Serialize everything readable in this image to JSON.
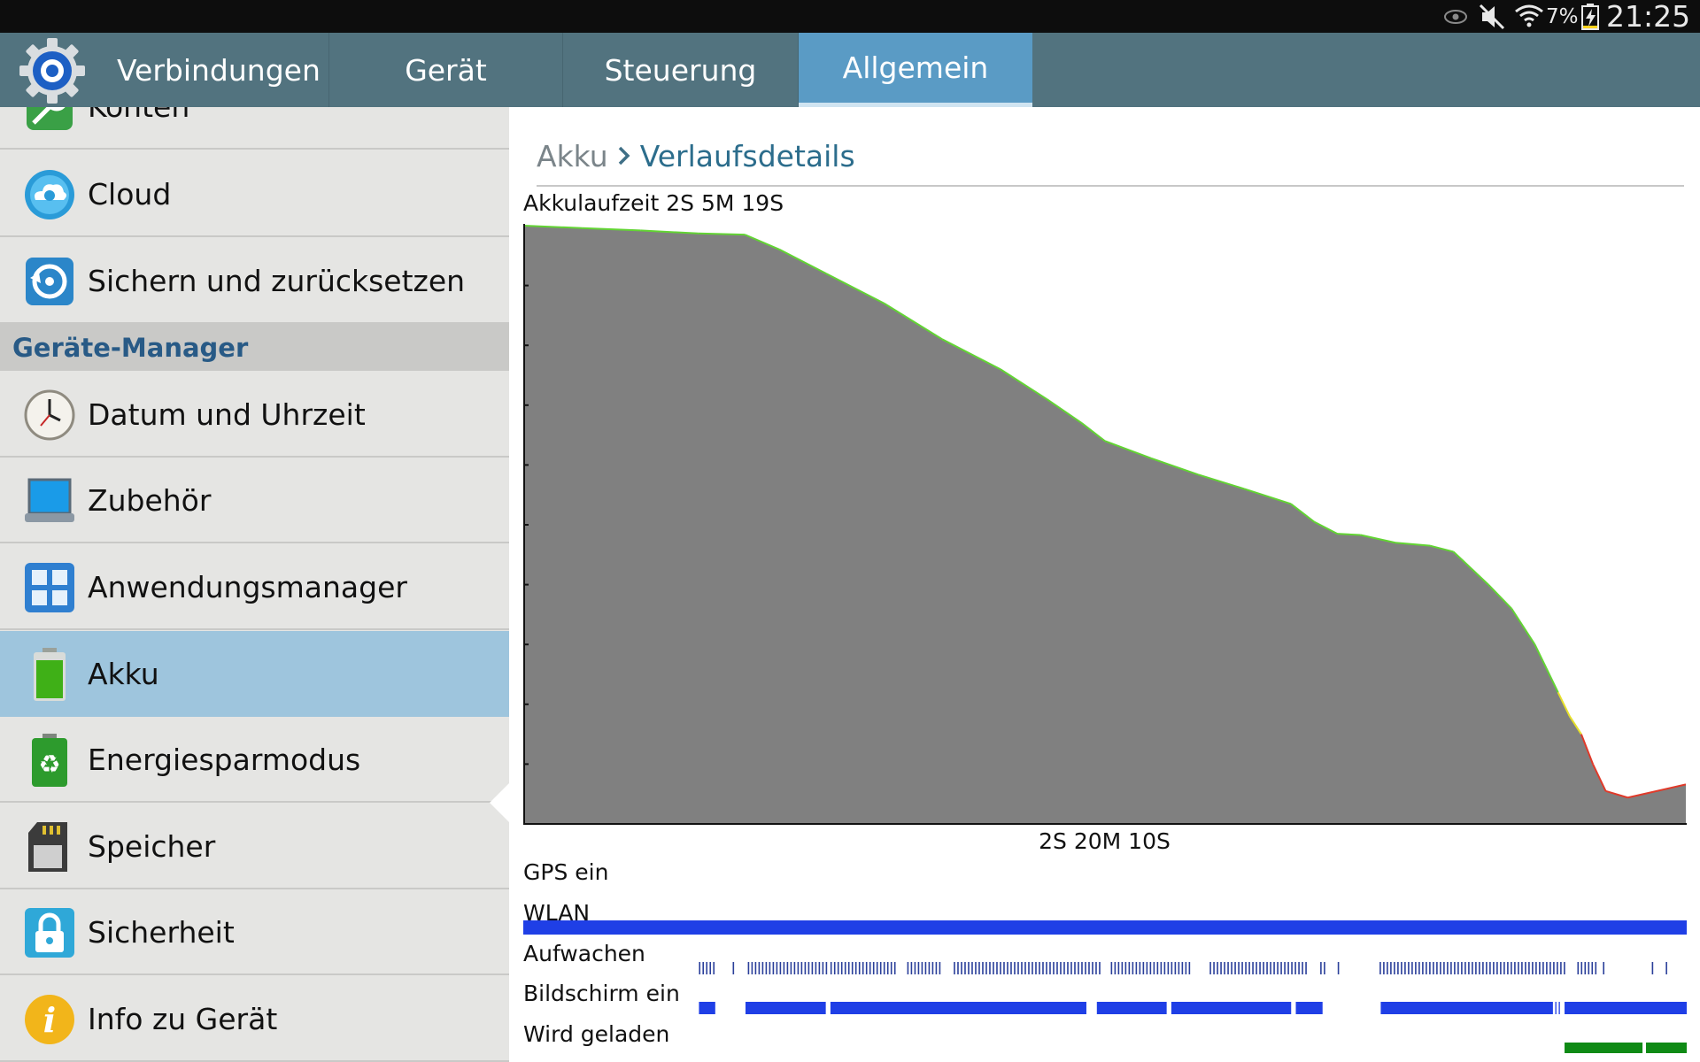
{
  "status_bar": {
    "icons": [
      "eye-icon",
      "mute-icon",
      "wifi-icon",
      "battery-charging-icon"
    ],
    "battery_percent": "7%",
    "time": "21:25"
  },
  "tabs": [
    {
      "label": "Verbindungen",
      "selected": false
    },
    {
      "label": "Gerät",
      "selected": false
    },
    {
      "label": "Steuerung",
      "selected": false
    },
    {
      "label": "Allgemein",
      "selected": true
    }
  ],
  "sidebar": {
    "items_top": [
      {
        "label": "Konten",
        "icon": "key-icon"
      },
      {
        "label": "Cloud",
        "icon": "cloud-icon"
      },
      {
        "label": "Sichern und zurücksetzen",
        "icon": "backup-restore-icon"
      }
    ],
    "section_title": "Geräte-Manager",
    "items": [
      {
        "label": "Datum und Uhrzeit",
        "icon": "clock-icon"
      },
      {
        "label": "Zubehör",
        "icon": "accessory-icon"
      },
      {
        "label": "Anwendungsmanager",
        "icon": "app-grid-icon"
      },
      {
        "label": "Akku",
        "icon": "battery-icon",
        "active": true
      },
      {
        "label": "Energiesparmodus",
        "icon": "power-saving-icon"
      },
      {
        "label": "Speicher",
        "icon": "sd-card-icon"
      },
      {
        "label": "Sicherheit",
        "icon": "lock-icon"
      },
      {
        "label": "Info zu Gerät",
        "icon": "info-icon"
      }
    ]
  },
  "breadcrumb": {
    "parent": "Akku",
    "separator": "›",
    "current": "Verlaufsdetails"
  },
  "battery_history": {
    "runtime_label": "Akkulaufzeit 2S 5M 19S",
    "duration_label": "2S 20M 10S",
    "colors": {
      "fill": "#808080",
      "high": "#62d433",
      "mid": "#e6e02a",
      "low": "#e03a2a",
      "track": "#1f3fe6",
      "charging": "#0f8a15"
    }
  },
  "chart_data": {
    "type": "area",
    "title": "Akkulaufzeit 2S 5M 19S",
    "xlabel": "2S 20M 10S",
    "ylabel": "",
    "x_unit": "fraction of elapsed time",
    "y_unit": "fraction of battery capacity",
    "xlim": [
      0,
      1
    ],
    "ylim": [
      0,
      1
    ],
    "x": [
      0,
      0.05,
      0.1,
      0.15,
      0.19,
      0.22,
      0.26,
      0.31,
      0.36,
      0.41,
      0.45,
      0.48,
      0.5,
      0.54,
      0.58,
      0.62,
      0.66,
      0.6801,
      0.7,
      0.72,
      0.75,
      0.78,
      0.8,
      0.83,
      0.85,
      0.87,
      0.88,
      0.89,
      0.9,
      0.91,
      0.92,
      0.931,
      0.95,
      1
    ],
    "y": [
      1,
      0.996,
      0.992,
      0.987,
      0.985,
      0.96,
      0.92,
      0.87,
      0.81,
      0.76,
      0.71,
      0.67,
      0.64,
      0.611,
      0.584,
      0.56,
      0.535,
      0.505,
      0.485,
      0.483,
      0.47,
      0.465,
      0.455,
      0.4,
      0.36,
      0.3,
      0.26,
      0.22,
      0.18,
      0.15,
      0.1,
      0.055,
      0.044,
      0.066
    ],
    "tracks": [
      {
        "name": "GPS ein",
        "segments": []
      },
      {
        "name": "WLAN",
        "segments": [
          [
            0,
            1
          ]
        ]
      },
      {
        "name": "Aufwachen",
        "segments": [
          [
            0.151,
            0.165
          ],
          [
            0.18,
            0.183
          ],
          [
            0.193,
            0.26
          ],
          [
            0.264,
            0.319
          ],
          [
            0.33,
            0.36
          ],
          [
            0.37,
            0.496
          ],
          [
            0.505,
            0.572
          ],
          [
            0.59,
            0.673
          ],
          [
            0.685,
            0.689
          ],
          [
            0.7,
            0.701
          ],
          [
            0.736,
            0.896
          ],
          [
            0.906,
            0.924
          ],
          [
            0.928,
            0.93
          ],
          [
            0.97,
            0.971
          ],
          [
            0.982,
            0.984
          ]
        ]
      },
      {
        "name": "Bildschirm ein",
        "segments": [
          [
            0.151,
            0.165
          ],
          [
            0.191,
            0.26
          ],
          [
            0.264,
            0.484
          ],
          [
            0.493,
            0.553
          ],
          [
            0.557,
            0.66
          ],
          [
            0.664,
            0.687
          ],
          [
            0.737,
            0.885
          ],
          [
            0.887,
            0.888
          ],
          [
            0.89,
            0.891
          ],
          [
            0.895,
            1
          ]
        ]
      },
      {
        "name": "Wird geladen",
        "segments": [
          [
            0.895,
            0.962
          ],
          [
            0.965,
            1
          ]
        ]
      }
    ]
  }
}
